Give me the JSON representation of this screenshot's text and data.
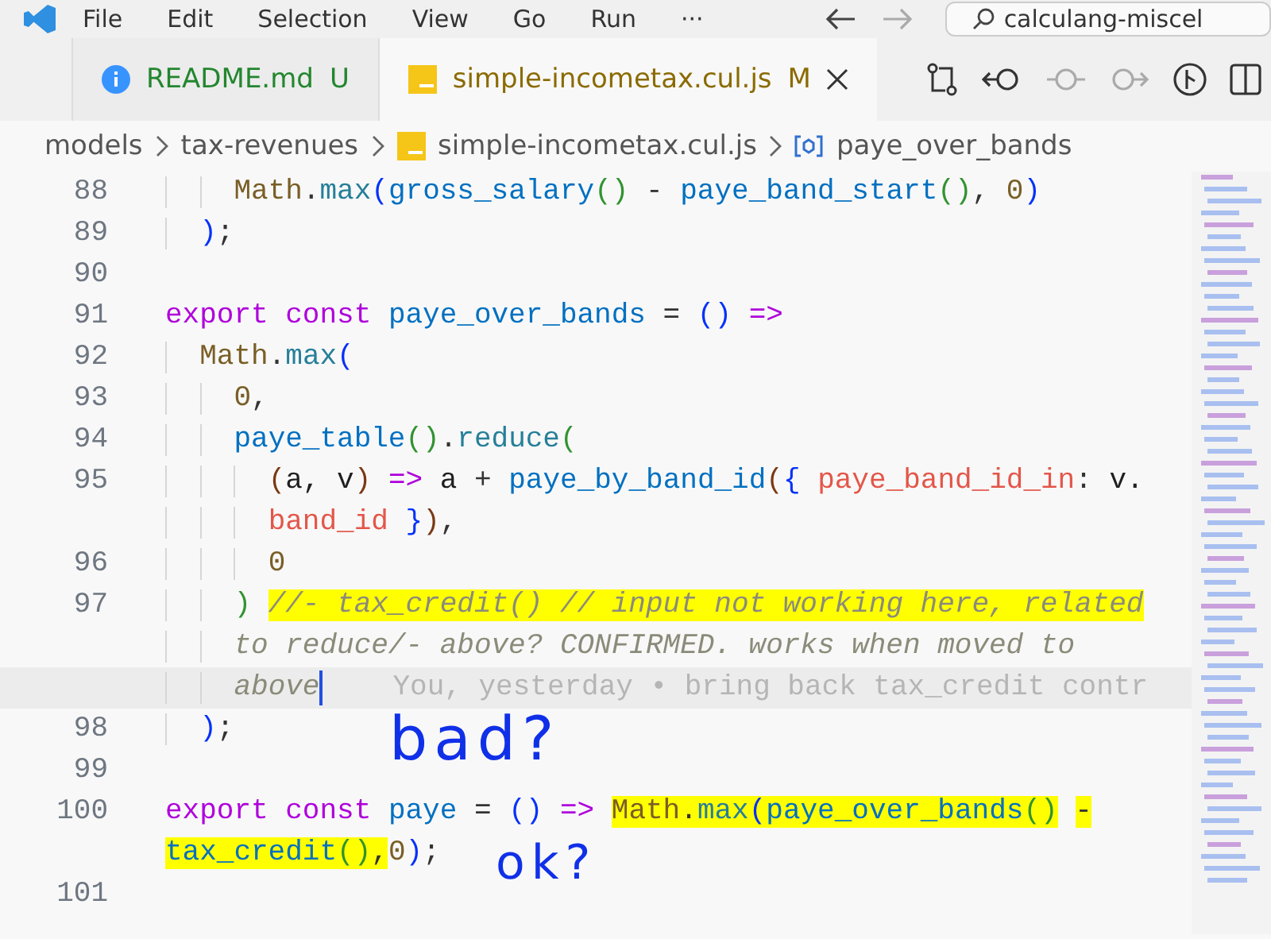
{
  "menu": [
    "File",
    "Edit",
    "Selection",
    "View",
    "Go",
    "Run",
    "···"
  ],
  "search": {
    "value": "calculang-miscel"
  },
  "tabs": [
    {
      "kind": "info",
      "label": "README.md",
      "badge": "U",
      "selected": false
    },
    {
      "kind": "js",
      "label": "simple-incometax.cul.js",
      "badge": "M",
      "selected": true
    }
  ],
  "breadcrumb": [
    {
      "kind": "folder",
      "text": "models"
    },
    {
      "kind": "folder",
      "text": "tax-revenues"
    },
    {
      "kind": "js",
      "text": "simple-incometax.cul.js"
    },
    {
      "kind": "symbol",
      "text": "paye_over_bands"
    }
  ],
  "lines": [
    {
      "number": "88",
      "rows": [
        {
          "current": false,
          "tokens": [
            {
              "kind": "class",
              "text": "    Math",
              "highlighted": false
            },
            {
              "kind": "punct",
              "text": ".",
              "highlighted": false
            },
            {
              "kind": "method",
              "text": "max",
              "highlighted": false
            },
            {
              "kind": "b1",
              "text": "(",
              "highlighted": false
            },
            {
              "kind": "fn",
              "text": "gross_salary",
              "highlighted": false
            },
            {
              "kind": "b2",
              "text": "()",
              "highlighted": false
            },
            {
              "kind": "punct",
              "text": " - ",
              "highlighted": false
            },
            {
              "kind": "fn",
              "text": "paye_band_start",
              "highlighted": false
            },
            {
              "kind": "b2",
              "text": "()",
              "highlighted": false
            },
            {
              "kind": "punct",
              "text": ", ",
              "highlighted": false
            },
            {
              "kind": "num",
              "text": "0",
              "highlighted": false
            },
            {
              "kind": "b1",
              "text": ")",
              "highlighted": false
            }
          ]
        }
      ]
    },
    {
      "number": "89",
      "rows": [
        {
          "current": false,
          "tokens": [
            {
              "kind": "b1",
              "text": "  )",
              "highlighted": false
            },
            {
              "kind": "punct",
              "text": ";",
              "highlighted": false
            }
          ]
        }
      ]
    },
    {
      "number": "90",
      "rows": [
        {
          "current": false,
          "tokens": []
        }
      ]
    },
    {
      "number": "91",
      "rows": [
        {
          "current": false,
          "tokens": [
            {
              "kind": "kw",
              "text": "export const ",
              "highlighted": false
            },
            {
              "kind": "fn",
              "text": "paye_over_bands",
              "highlighted": false
            },
            {
              "kind": "punct",
              "text": " = ",
              "highlighted": false
            },
            {
              "kind": "b1",
              "text": "()",
              "highlighted": false
            },
            {
              "kind": "kw",
              "text": " =>",
              "highlighted": false
            }
          ]
        }
      ]
    },
    {
      "number": "92",
      "rows": [
        {
          "current": false,
          "tokens": [
            {
              "kind": "class",
              "text": "  Math",
              "highlighted": false
            },
            {
              "kind": "punct",
              "text": ".",
              "highlighted": false
            },
            {
              "kind": "method",
              "text": "max",
              "highlighted": false
            },
            {
              "kind": "b1",
              "text": "(",
              "highlighted": false
            }
          ]
        }
      ]
    },
    {
      "number": "93",
      "rows": [
        {
          "current": false,
          "tokens": [
            {
              "kind": "num",
              "text": "    0",
              "highlighted": false
            },
            {
              "kind": "punct",
              "text": ",",
              "highlighted": false
            }
          ]
        }
      ]
    },
    {
      "number": "94",
      "rows": [
        {
          "current": false,
          "tokens": [
            {
              "kind": "fn",
              "text": "    paye_table",
              "highlighted": false
            },
            {
              "kind": "b2",
              "text": "()",
              "highlighted": false
            },
            {
              "kind": "punct",
              "text": ".",
              "highlighted": false
            },
            {
              "kind": "method",
              "text": "reduce",
              "highlighted": false
            },
            {
              "kind": "b2",
              "text": "(",
              "highlighted": false
            }
          ]
        }
      ]
    },
    {
      "number": "95",
      "rows": [
        {
          "current": false,
          "tokens": [
            {
              "kind": "b3",
              "text": "      (",
              "highlighted": false
            },
            {
              "kind": "param",
              "text": "a, v",
              "highlighted": false
            },
            {
              "kind": "b3",
              "text": ")",
              "highlighted": false
            },
            {
              "kind": "kw",
              "text": " => ",
              "highlighted": false
            },
            {
              "kind": "param",
              "text": "a",
              "highlighted": false
            },
            {
              "kind": "punct",
              "text": " + ",
              "highlighted": false
            },
            {
              "kind": "fn",
              "text": "paye_by_band_id",
              "highlighted": false
            },
            {
              "kind": "b3",
              "text": "(",
              "highlighted": false
            },
            {
              "kind": "b1",
              "text": "{ ",
              "highlighted": false
            },
            {
              "kind": "prop",
              "text": "paye_band_id_in",
              "highlighted": false
            },
            {
              "kind": "punct",
              "text": ": ",
              "highlighted": false
            },
            {
              "kind": "param",
              "text": "v.",
              "highlighted": false
            }
          ]
        },
        {
          "current": false,
          "tokens": [
            {
              "kind": "prop",
              "text": "      band_id",
              "highlighted": false
            },
            {
              "kind": "b1",
              "text": " }",
              "highlighted": false
            },
            {
              "kind": "b3",
              "text": ")",
              "highlighted": false
            },
            {
              "kind": "punct",
              "text": ",",
              "highlighted": false
            }
          ]
        }
      ]
    },
    {
      "number": "96",
      "rows": [
        {
          "current": false,
          "tokens": [
            {
              "kind": "num",
              "text": "      0",
              "highlighted": false
            }
          ]
        }
      ]
    },
    {
      "number": "97",
      "rows": [
        {
          "current": false,
          "tokens": [
            {
              "kind": "b2",
              "text": "    ) ",
              "highlighted": false
            },
            {
              "kind": "comment",
              "text": "//- tax_credit() // input not working here, related",
              "highlighted": true
            }
          ]
        },
        {
          "current": false,
          "tokens": [
            {
              "kind": "comment",
              "text": "    to reduce/- above? CONFIRMED. works when moved to",
              "highlighted": false
            }
          ]
        },
        {
          "current": true,
          "blame": "You, yesterday • bring back tax_credit contr",
          "tokens": [
            {
              "kind": "comment",
              "text": "    above",
              "highlighted": false
            }
          ]
        }
      ]
    },
    {
      "number": "98",
      "rows": [
        {
          "current": false,
          "tokens": [
            {
              "kind": "b1",
              "text": "  )",
              "highlighted": false
            },
            {
              "kind": "punct",
              "text": ";",
              "highlighted": false
            }
          ]
        }
      ]
    },
    {
      "number": "99",
      "rows": [
        {
          "current": false,
          "tokens": []
        }
      ]
    },
    {
      "number": "100",
      "rows": [
        {
          "current": false,
          "tokens": [
            {
              "kind": "kw",
              "text": "export const ",
              "highlighted": false
            },
            {
              "kind": "fn",
              "text": "paye",
              "highlighted": false
            },
            {
              "kind": "punct",
              "text": " = ",
              "highlighted": false
            },
            {
              "kind": "b1",
              "text": "()",
              "highlighted": false
            },
            {
              "kind": "kw",
              "text": " => ",
              "highlighted": false
            },
            {
              "kind": "class",
              "text": "Math",
              "highlighted": true
            },
            {
              "kind": "punct",
              "text": ".",
              "highlighted": true
            },
            {
              "kind": "method",
              "text": "max",
              "highlighted": true
            },
            {
              "kind": "b1",
              "text": "(",
              "highlighted": true
            },
            {
              "kind": "fn",
              "text": "paye_over_bands",
              "highlighted": true
            },
            {
              "kind": "b2",
              "text": "()",
              "highlighted": true
            },
            {
              "kind": "punct",
              "text": " -",
              "highlighted": true
            }
          ]
        },
        {
          "current": false,
          "tokens": [
            {
              "kind": "fn",
              "text": "tax_credit",
              "highlighted": true
            },
            {
              "kind": "b2",
              "text": "()",
              "highlighted": true
            },
            {
              "kind": "punct",
              "text": ",",
              "highlighted": true
            },
            {
              "kind": "num",
              "text": "0",
              "highlighted": false
            },
            {
              "kind": "b1",
              "text": ")",
              "highlighted": false
            },
            {
              "kind": "punct",
              "text": ";",
              "highlighted": false
            }
          ]
        }
      ]
    },
    {
      "number": "101",
      "rows": [
        {
          "current": false,
          "tokens": []
        }
      ]
    }
  ],
  "annotations": [
    {
      "kind": "bad",
      "text": "bad?"
    },
    {
      "kind": "ok",
      "text": "ok?"
    }
  ]
}
